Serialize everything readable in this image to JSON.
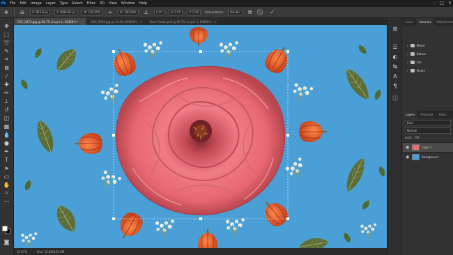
{
  "menu": {
    "logo": "Ps",
    "items": [
      "File",
      "Edit",
      "Image",
      "Layer",
      "Type",
      "Select",
      "Filter",
      "3D",
      "View",
      "Window",
      "Help"
    ],
    "win_min": "–",
    "win_max": "□",
    "win_close": "×"
  },
  "options": {
    "x": "X: 893.8 px",
    "y": "Y: 1899.86 px",
    "w": "W: 100.00%",
    "h": "H: 100.00%",
    "angle": "0.00",
    "hskew": "H: 0.00",
    "vskew": "V: 0.00",
    "interpolation_label": "Interpolation:",
    "interpolation_value": "Bicubic",
    "cancel": "⃠",
    "commit": "✓"
  },
  "tabs": [
    {
      "label": "DSC_0472.jpg @ 66.7% (Layer 1, RGB/8*) *",
      "close": "×"
    },
    {
      "label": "DSC_0904.jpg @ 33.3% (RGB/8*)",
      "close": "×"
    },
    {
      "label": "Rose Flower.psd @ 66.7% (Layer 1, RGB/8*)",
      "close": "×"
    }
  ],
  "status": {
    "zoom": "33.67%",
    "doc": "Doc: 52.8M/103.6M"
  },
  "right_panel": {
    "top_tabs": [
      "Learn",
      "Libraries",
      "Adjustments"
    ],
    "libraries": [
      "Mixed",
      "Nature",
      "Fire",
      "Plants"
    ],
    "layer_tabs": [
      "Layers",
      "Channels",
      "Paths"
    ],
    "kind": "Kind",
    "blend": "Normal",
    "opacity": "Opacity:",
    "lock": "Lock:",
    "fill": "Fill:",
    "layers": [
      {
        "name": "Layer 1",
        "selected": true
      },
      {
        "name": "Background",
        "selected": false
      }
    ]
  },
  "colors": {
    "canvas_bg": "#4aa0d6",
    "rose": "#e46f73",
    "lantern": "#e2542b",
    "leaf": "#5b6b34",
    "foreground": "#ffffff",
    "background": "#000000"
  }
}
